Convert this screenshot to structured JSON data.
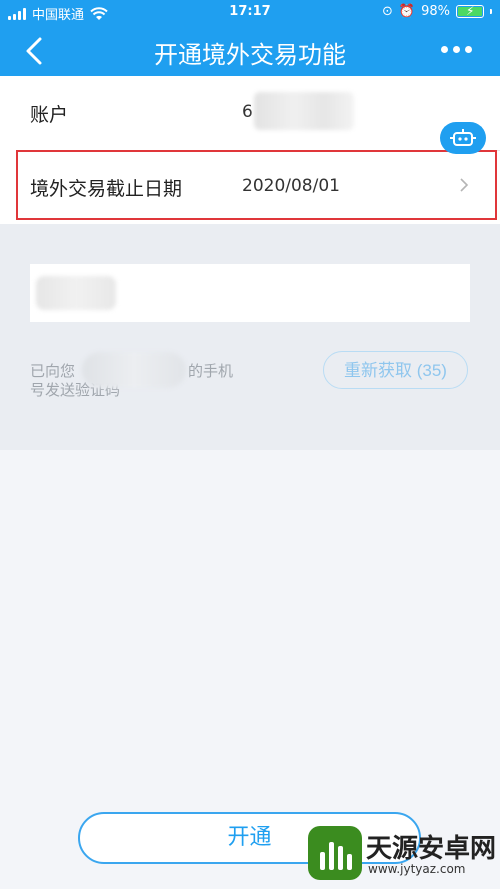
{
  "status_bar": {
    "carrier": "中国联通",
    "time": "17:17",
    "battery": "98%"
  },
  "nav": {
    "title": "开通境外交易功能"
  },
  "account": {
    "label": "账户",
    "value_visible": "6"
  },
  "deadline": {
    "label": "境外交易截止日期",
    "value": "2020/08/01"
  },
  "sms": {
    "text_part1": "已向您",
    "text_part2": "的手机号发送验证码",
    "resend_label": "重新获取 (35)"
  },
  "submit": {
    "label": "开通"
  },
  "watermark": {
    "title": "天源安卓网",
    "url": "www.jytyaz.com"
  },
  "colors": {
    "primary": "#1f9ff0",
    "highlight": "#e0363a"
  }
}
